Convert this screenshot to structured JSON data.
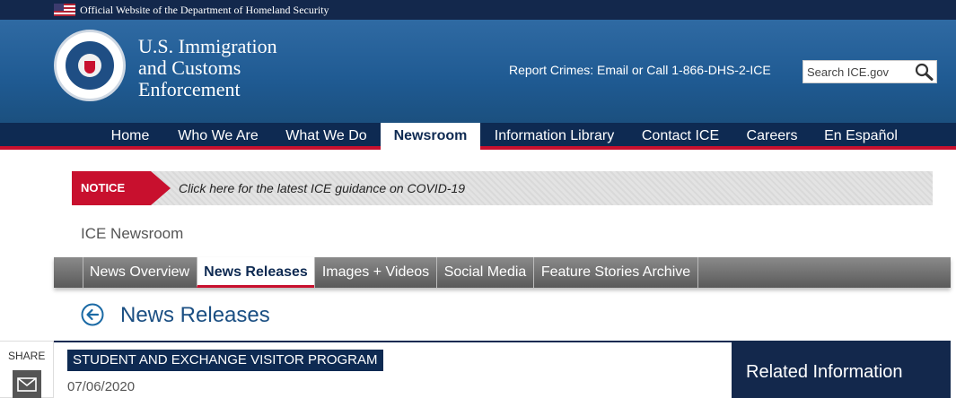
{
  "official_bar": {
    "text": "Official Website of the Department of Homeland Security"
  },
  "header": {
    "agency_line1": "U.S. Immigration",
    "agency_line2": "and Customs",
    "agency_line3": "Enforcement",
    "report_text": "Report Crimes: Email or Call 1-866-DHS-2-ICE",
    "search_placeholder": "Search ICE.gov",
    "seal_icon": "dhs-seal-icon",
    "search_icon": "search-icon"
  },
  "nav": {
    "items": [
      {
        "label": "Home"
      },
      {
        "label": "Who We Are"
      },
      {
        "label": "What We Do"
      },
      {
        "label": "Newsroom"
      },
      {
        "label": "Information Library"
      },
      {
        "label": "Contact ICE"
      },
      {
        "label": "Careers"
      },
      {
        "label": "En Español"
      }
    ],
    "active": "Newsroom"
  },
  "notice": {
    "label": "NOTICE",
    "text": "Click here for the latest ICE guidance on COVID-19"
  },
  "newsroom": {
    "title": "ICE Newsroom"
  },
  "subtabs": {
    "items": [
      {
        "label": "News Overview"
      },
      {
        "label": "News Releases"
      },
      {
        "label": "Images + Videos"
      },
      {
        "label": "Social Media"
      },
      {
        "label": "Feature Stories Archive"
      }
    ],
    "active": "News Releases"
  },
  "page": {
    "heading": "News Releases",
    "back_icon": "circle-arrow-left-icon"
  },
  "share": {
    "label": "SHARE",
    "mail_icon": "mail-icon"
  },
  "article": {
    "program": "STUDENT AND EXCHANGE VISITOR PROGRAM",
    "date": "07/06/2020"
  },
  "sidebar": {
    "related_title": "Related Information"
  },
  "colors": {
    "navy": "#0e2a52",
    "header_blue": "#1f5a92",
    "accent_red": "#c8102e"
  }
}
